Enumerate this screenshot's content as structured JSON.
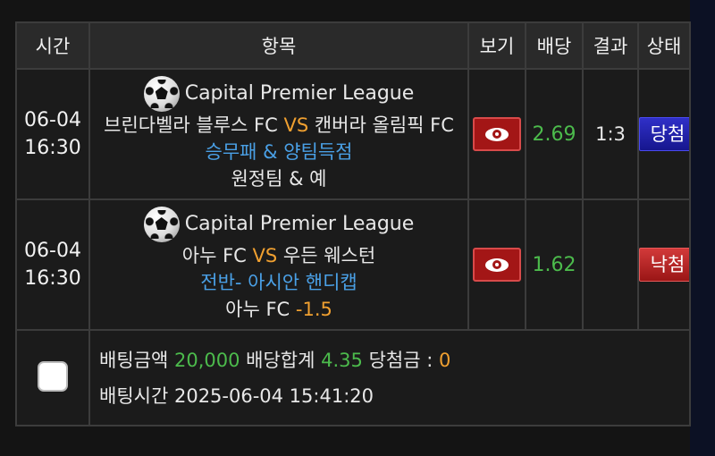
{
  "headers": {
    "time": "시간",
    "item": "항목",
    "view": "보기",
    "odds": "배당",
    "result": "결과",
    "status": "상태"
  },
  "bets": [
    {
      "date": "06-04",
      "time": "16:30",
      "league": "Capital Premier League",
      "home": "브린다벨라 블루스 FC",
      "vs": "VS",
      "away": "캔버라 올림픽 FC",
      "market": "승무패 & 양팀득점",
      "pick_text": "원정팀 & 예",
      "pick_line": "",
      "odds": "2.69",
      "result": "1:3",
      "status": "당첨",
      "status_type": "win"
    },
    {
      "date": "06-04",
      "time": "16:30",
      "league": "Capital Premier League",
      "home": "아누 FC",
      "vs": "VS",
      "away": "우든 웨스턴",
      "market": "전반- 아시안 핸디캡",
      "pick_text": "아누 FC",
      "pick_line": "-1.5",
      "odds": "1.62",
      "result": "",
      "status": "낙첨",
      "status_type": "lose"
    }
  ],
  "summary": {
    "bet_amount_label": "배팅금액",
    "bet_amount": "20,000",
    "odds_total_label": "배당합계",
    "odds_total": "4.35",
    "win_amount_label": "당첨금 :",
    "win_amount": "0",
    "bet_time_label": "배팅시간",
    "bet_time": "2025-06-04 15:41:20"
  }
}
